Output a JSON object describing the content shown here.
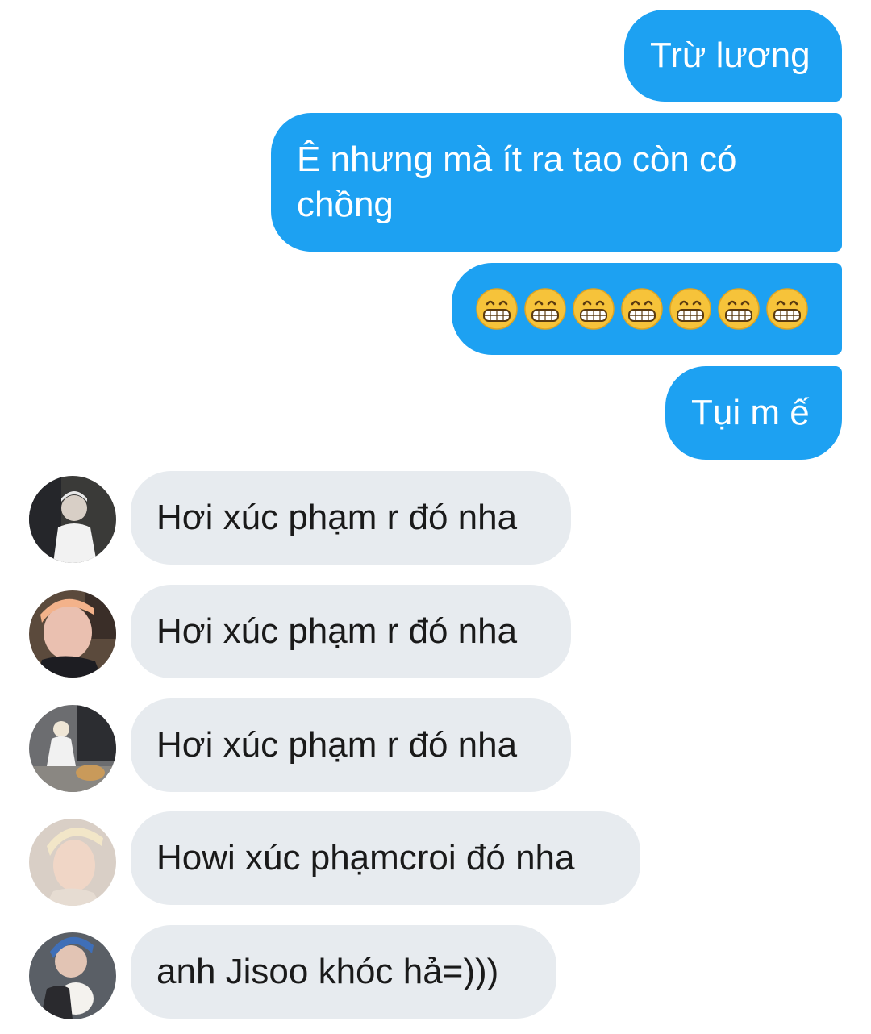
{
  "sent_messages": [
    {
      "text": "Trừ lương"
    },
    {
      "text": "Ê nhưng mà ít ra tao còn có chồng"
    },
    {
      "text": "😁😁😁😁😁😁😁",
      "emoji_name": "grinning-face-with-smiling-eyes",
      "emoji_count": 7
    },
    {
      "text": "Tụi m ế"
    }
  ],
  "received_messages": [
    {
      "text": "Hơi xúc phạm r đó nha",
      "avatar": "avatar-user-1"
    },
    {
      "text": "Hơi xúc phạm r đó nha",
      "avatar": "avatar-user-2"
    },
    {
      "text": "Hơi xúc phạm r đó nha",
      "avatar": "avatar-user-3"
    },
    {
      "text": "Howi xúc phạmcroi đó nha",
      "avatar": "avatar-user-4"
    },
    {
      "text": "anh Jisoo khóc hả=)))",
      "avatar": "avatar-user-5"
    }
  ],
  "colors": {
    "sent_bubble": "#1da1f2",
    "received_bubble": "#e7ebef",
    "background": "#ffffff"
  }
}
